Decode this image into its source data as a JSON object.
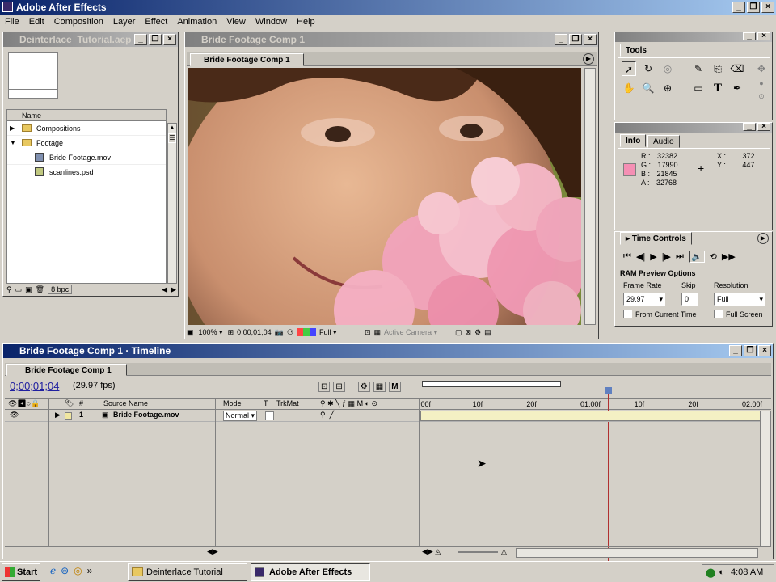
{
  "app": {
    "title": "Adobe After Effects",
    "menu": [
      "File",
      "Edit",
      "Composition",
      "Layer",
      "Effect",
      "Animation",
      "View",
      "Window",
      "Help"
    ]
  },
  "project": {
    "title": "Deinterlace_Tutorial.aep *",
    "column_name": "Name",
    "items": [
      {
        "label": "Compositions",
        "type": "folder",
        "indent": 0
      },
      {
        "label": "Footage",
        "type": "folder",
        "indent": 0
      },
      {
        "label": "Bride Footage.mov",
        "type": "movie",
        "indent": 1
      },
      {
        "label": "scanlines.psd",
        "type": "image",
        "indent": 1
      }
    ],
    "bpc": "8 bpc"
  },
  "comp": {
    "window_title": "Bride Footage Comp 1",
    "tab_label": "Bride Footage Comp 1",
    "zoom": "100%",
    "timecode": "0;00;01;04",
    "resolution": "Full",
    "camera": "Active Camera"
  },
  "tools": {
    "title": "Tools"
  },
  "info": {
    "tabs": [
      "Info",
      "Audio"
    ],
    "r_label": "R :",
    "r_value": "32382",
    "g_label": "G :",
    "g_value": "17990",
    "b_label": "B :",
    "b_value": "21845",
    "a_label": "A :",
    "a_value": "32768",
    "x_label": "X :",
    "x_value": "372",
    "y_label": "Y :",
    "y_value": "447",
    "swatch_color": "#f58fb4"
  },
  "time_controls": {
    "title": "Time Controls",
    "ram_preview_label": "RAM Preview Options",
    "frame_rate_label": "Frame Rate",
    "frame_rate_value": "29.97",
    "skip_label": "Skip",
    "skip_value": "0",
    "resolution_label": "Resolution",
    "resolution_value": "Full",
    "from_current_label": "From Current Time",
    "full_screen_label": "Full Screen"
  },
  "timeline": {
    "window_title": "Bride Footage Comp 1 · Timeline",
    "tab_label": "Bride Footage Comp 1",
    "timecode": "0;00;01;04",
    "fps": "(29.97 fps)",
    "col_num": "#",
    "col_source": "Source Name",
    "col_mode": "Mode",
    "col_t": "T",
    "col_trkmat": "TrkMat",
    "ruler": [
      ":00f",
      "10f",
      "20f",
      "01:00f",
      "10f",
      "20f",
      "02:00f"
    ],
    "layers": [
      {
        "num": "1",
        "name": "Bride Footage.mov",
        "mode": "Normal"
      }
    ]
  },
  "taskbar": {
    "start": "Start",
    "tasks": [
      "Deinterlace Tutorial",
      "Adobe After Effects"
    ],
    "clock": "4:08 AM"
  }
}
